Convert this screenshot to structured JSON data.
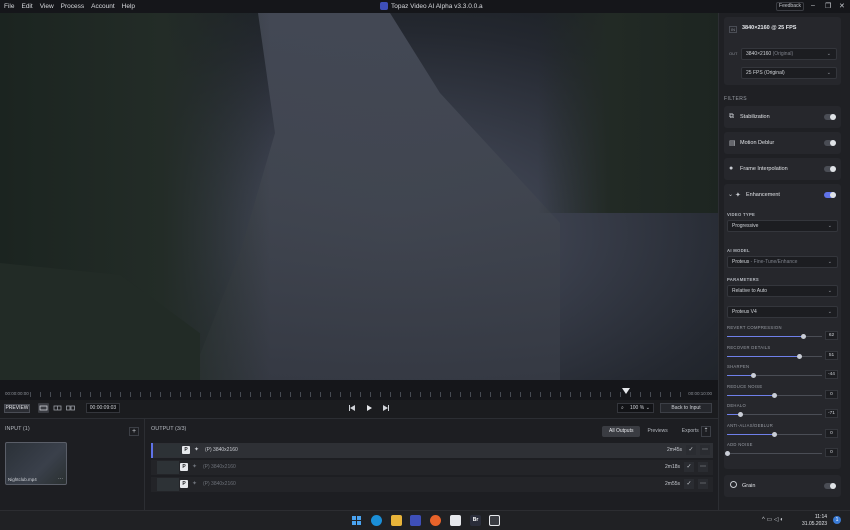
{
  "titlebar": {
    "menu": [
      "File",
      "Edit",
      "View",
      "Process",
      "Account",
      "Help"
    ],
    "app_title": "Topaz Video AI Alpha  v3.3.0.0.a",
    "feedback": "Feedback"
  },
  "timeline": {
    "start": "00:00:00:00",
    "end": "00:00:10:00"
  },
  "controls": {
    "preview": "PREVIEW",
    "timecode": "00:00:09:03",
    "zoom": "100  %",
    "back_to_input": "Back to Input"
  },
  "input_panel": {
    "title": "INPUT (1)",
    "file_name": "Nightclub.mp4",
    "more": "···"
  },
  "output_panel": {
    "title": "OUTPUT (3/3)",
    "tabs": [
      "All Outputs",
      "Previews",
      "Exports"
    ],
    "rows": [
      {
        "badge": "P",
        "wand": "✦",
        "res": "(P)  3840x2160",
        "dur": "2m45s"
      },
      {
        "badge": "P",
        "wand": "✦",
        "res": "(P)  3840x2160",
        "dur": "2m18s"
      },
      {
        "badge": "P",
        "wand": "✦",
        "res": "(P)  3840x2160",
        "dur": "2m55s"
      }
    ]
  },
  "right_panel": {
    "input_label": "IN",
    "input_res": "3840×2160 @ 25 FPS",
    "output_label": "OUT",
    "out_res": "3840×2160",
    "out_res_note": "(Original)",
    "out_fps": "25 FPS (Original)",
    "filters_title": "FILTERS",
    "filters": [
      "Stabilization",
      "Motion Deblur",
      "Frame Interpolation"
    ],
    "enhancement": "Enhancement",
    "video_type_label": "VIDEO TYPE",
    "video_type": "Progressive",
    "ai_model_label": "AI MODEL",
    "ai_model": "Proteus",
    "ai_model_note": "- Fine-Tune/Enhance",
    "parameters_label": "PARAMETERS",
    "parameters": "Relative to Auto",
    "model_version": "Proteus V4",
    "sliders": [
      {
        "label": "REVERT COMPRESSION",
        "value": "62",
        "pct": 0.81
      },
      {
        "label": "RECOVER DETAILS",
        "value": "51",
        "pct": 0.76
      },
      {
        "label": "SHARPEN",
        "value": "-44",
        "pct": 0.28
      },
      {
        "label": "REDUCE NOISE",
        "value": "0",
        "pct": 0.5
      },
      {
        "label": "DEHALO",
        "value": "-71",
        "pct": 0.14
      },
      {
        "label": "ANTI-ALIAS/DEBLUR",
        "value": "0",
        "pct": 0.5
      },
      {
        "label": "ADD NOISE",
        "value": "0",
        "pct": 0.0
      }
    ],
    "grain": "Grain"
  },
  "taskbar": {
    "time": "11:14",
    "date": "31.05.2023"
  }
}
